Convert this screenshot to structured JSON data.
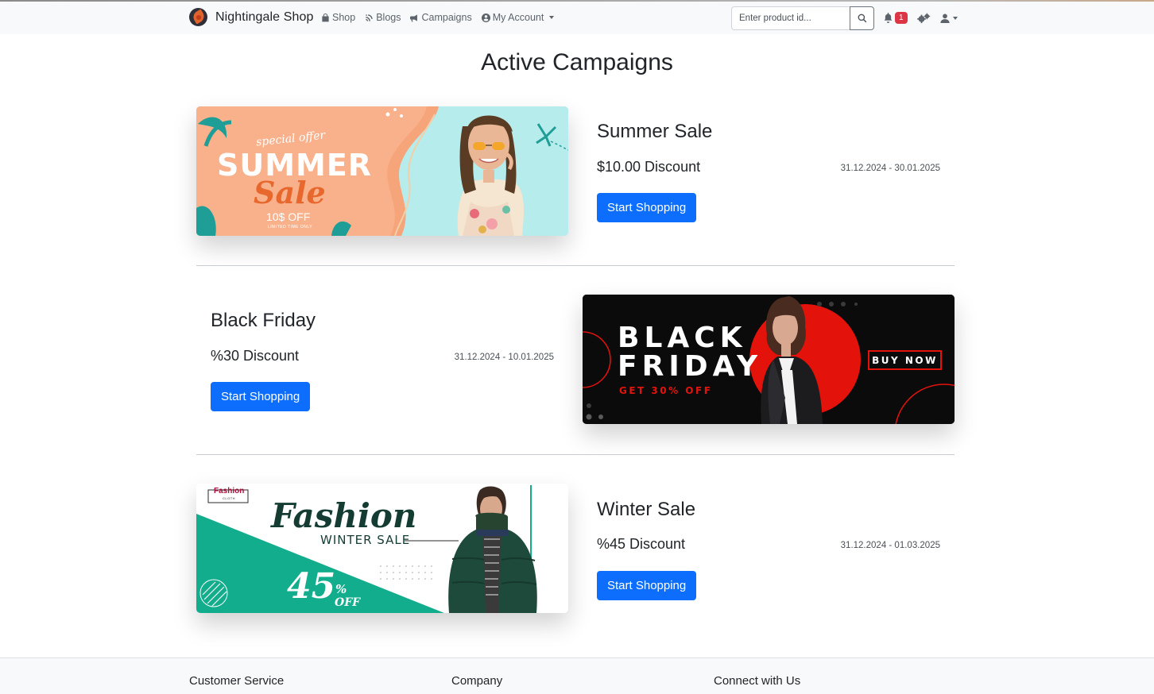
{
  "navbar": {
    "brand": "Nightingale Shop",
    "links": [
      {
        "label": "Shop",
        "icon": "shopping-bag-icon"
      },
      {
        "label": "Blogs",
        "icon": "blog-icon"
      },
      {
        "label": "Campaigns",
        "icon": "megaphone-icon"
      },
      {
        "label": "My Account",
        "icon": "user-circle-icon"
      }
    ],
    "search_placeholder": "Enter product id...",
    "notification_count": "1"
  },
  "page": {
    "title": "Active Campaigns"
  },
  "campaigns": [
    {
      "title": "Summer Sale",
      "discount": "$10.00 Discount",
      "dates": "31.12.2024 - 30.01.2025",
      "button": "Start Shopping",
      "banner": {
        "kicker": "special offer",
        "headline": "SUMMER",
        "script": "Sale",
        "offer": "10$ OFF",
        "fine": "LIMITED TIME ONLY"
      }
    },
    {
      "title": "Black Friday",
      "discount": "%30 Discount",
      "dates": "31.12.2024 - 10.01.2025",
      "button": "Start Shopping",
      "banner": {
        "line1": "BLACK",
        "line2": "FRIDAY",
        "offer": "GET 30% OFF",
        "cta": "BUY NOW"
      }
    },
    {
      "title": "Winter Sale",
      "discount": "%45 Discount",
      "dates": "31.12.2024 - 01.03.2025",
      "button": "Start Shopping",
      "banner": {
        "logo": "Fashion",
        "logo_sub": "CLOTH",
        "script": "Fashion",
        "subhead": "WINTER SALE",
        "number": "45",
        "percent": "%",
        "off": "OFF"
      }
    }
  ],
  "footer": {
    "columns": [
      "Customer Service",
      "Company",
      "Connect with Us"
    ]
  },
  "colors": {
    "primary": "#0d6efd",
    "badge": "#dc3545",
    "navbar_bg": "#f8f9fa"
  }
}
